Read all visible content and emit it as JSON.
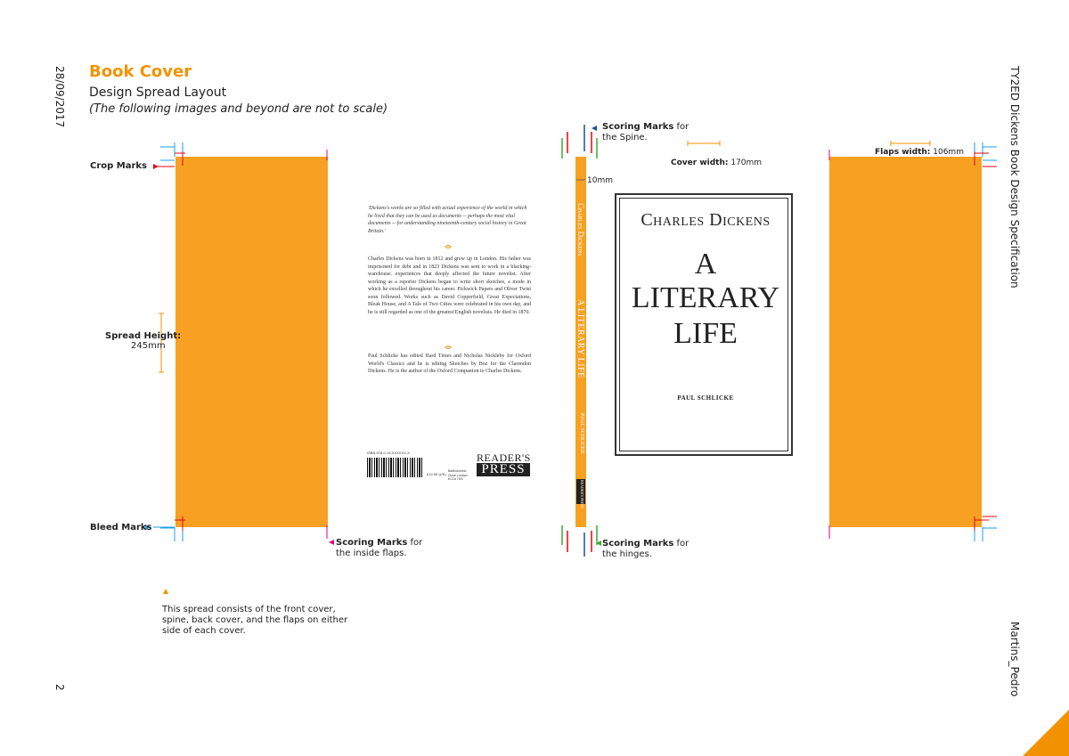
{
  "header": {
    "title": "Book Cover",
    "subtitle": "Design Spread Layout",
    "note": "(The following images and beyond are not to scale)"
  },
  "side": {
    "date": "28/09/2017",
    "page_number": "2",
    "spec_title": "TY2ED Dickens Book Design Specification",
    "author": "Martins_Pedro"
  },
  "labels": {
    "crop_marks": "Crop Marks",
    "bleed_marks": "Bleed Marks",
    "spread_height_label": "Spread Height:",
    "spread_height_value": "245mm",
    "scoring_spine_bold": "Scoring Marks",
    "scoring_spine_rest": " for",
    "scoring_spine_line2": "the Spine.",
    "scoring_flaps_bold": "Scoring Marks",
    "scoring_flaps_rest": " for",
    "scoring_flaps_line2": "the inside flaps.",
    "scoring_hinges_bold": "Scoring Marks",
    "scoring_hinges_rest": " for",
    "scoring_hinges_line2": "the hinges.",
    "cover_width_label": "Cover width:",
    "cover_width_value": " 170mm",
    "flaps_width_label": "Flaps width:",
    "flaps_width_value": " 106mm",
    "spine_width": "10mm",
    "footnote_line1": "This spread consists of the front cover,",
    "footnote_line2": "spine, back cover, and the flaps on either",
    "footnote_line3": "side of each cover."
  },
  "back_cover": {
    "quote": "'Dickens's works are so filled with actual experience of the world in which he lived that they can be used as documents -- perhaps the most vital documents -- for understanding nineteenth-century social history in Great Britain.'",
    "para1": "Charles Dickens was born in 1812 and grew up in London. His father was imprisoned for debt and in 1823 Dickens was sent to work in a blacking-warehouse. experiences that deeply affected the future novelist. After working as a reporter Dickens began to write short sketches, a mode in which he excelled throughout his career. Pickwick Papers and Oliver Twist soon followed. Works such as David Copperfield, Great Expectations, Bleak House, and A Tale of Two Cities were celebrated in his own day, and he is still regarded as one of the greatest English novelists. He died in 1870.",
    "para2": "Paul Schlicke has edited Hard Times and Nicholas Nickleby for Oxford World's Classics and he is editing Sketches by Boz for the Clarendon Dickens. He is the author of the Oxford Companion to Charles Dickens.",
    "isbn": "ISBN 978-0-19-XXXXXX-X",
    "price": "£14.99 (UK)",
    "address": "Bartholomew Close London EC1A 7DS",
    "publisher_line1": "READER'S",
    "publisher_line2": "PRESS"
  },
  "front_cover": {
    "author": "Charles Dickens",
    "title_line1": "A",
    "title_line2": "LITERARY",
    "title_line3": "LIFE",
    "byline": "PAUL SCHLICKE"
  },
  "spine": {
    "author": "Charles Dickens",
    "title": "A LITERARY LIFE",
    "byline": "PAUL SCHLICKE",
    "publisher": "READER'S PRESS"
  },
  "colors": {
    "accent": "#f39200",
    "panel": "#f7a021",
    "crop": "#e6007e",
    "bleed": "#1ba1e2",
    "red_mark": "#e30613",
    "green_mark": "#3aaa35",
    "blue_mark": "#1d4f9c"
  }
}
